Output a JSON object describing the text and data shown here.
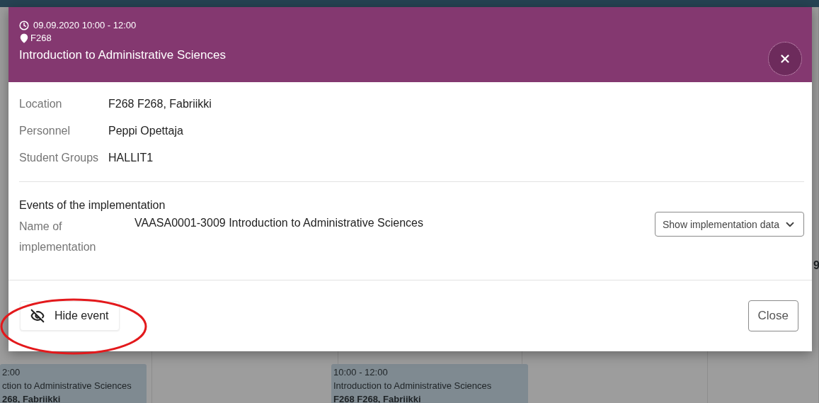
{
  "header": {
    "time": "09.09.2020 10:00 - 12:00",
    "room": "F268",
    "title": "Introduction to Administrative Sciences"
  },
  "details": [
    {
      "label": "Location",
      "value": "F268 F268, Fabriikki"
    },
    {
      "label": "Personnel",
      "value": "Peppi Opettaja"
    },
    {
      "label": "Student Groups",
      "value": "HALLIT1"
    }
  ],
  "implementation": {
    "heading": "Events of the implementation",
    "label": "Name of implementation",
    "value": "VAASA0001-3009 Introduction to Administrative Sciences",
    "toggle": "Show implementation data"
  },
  "footer": {
    "hide_button": "Hide event",
    "close_button": "Close"
  },
  "background_events": [
    {
      "time": "2:00",
      "title": "ction to Administrative Sciences",
      "location": "268, Fabriikki"
    },
    {
      "time": "10:00 - 12:00",
      "title": "Introduction to Administrative Sciences",
      "location": "F268 F268, Fabriikki"
    }
  ],
  "background_fragment": "9"
}
